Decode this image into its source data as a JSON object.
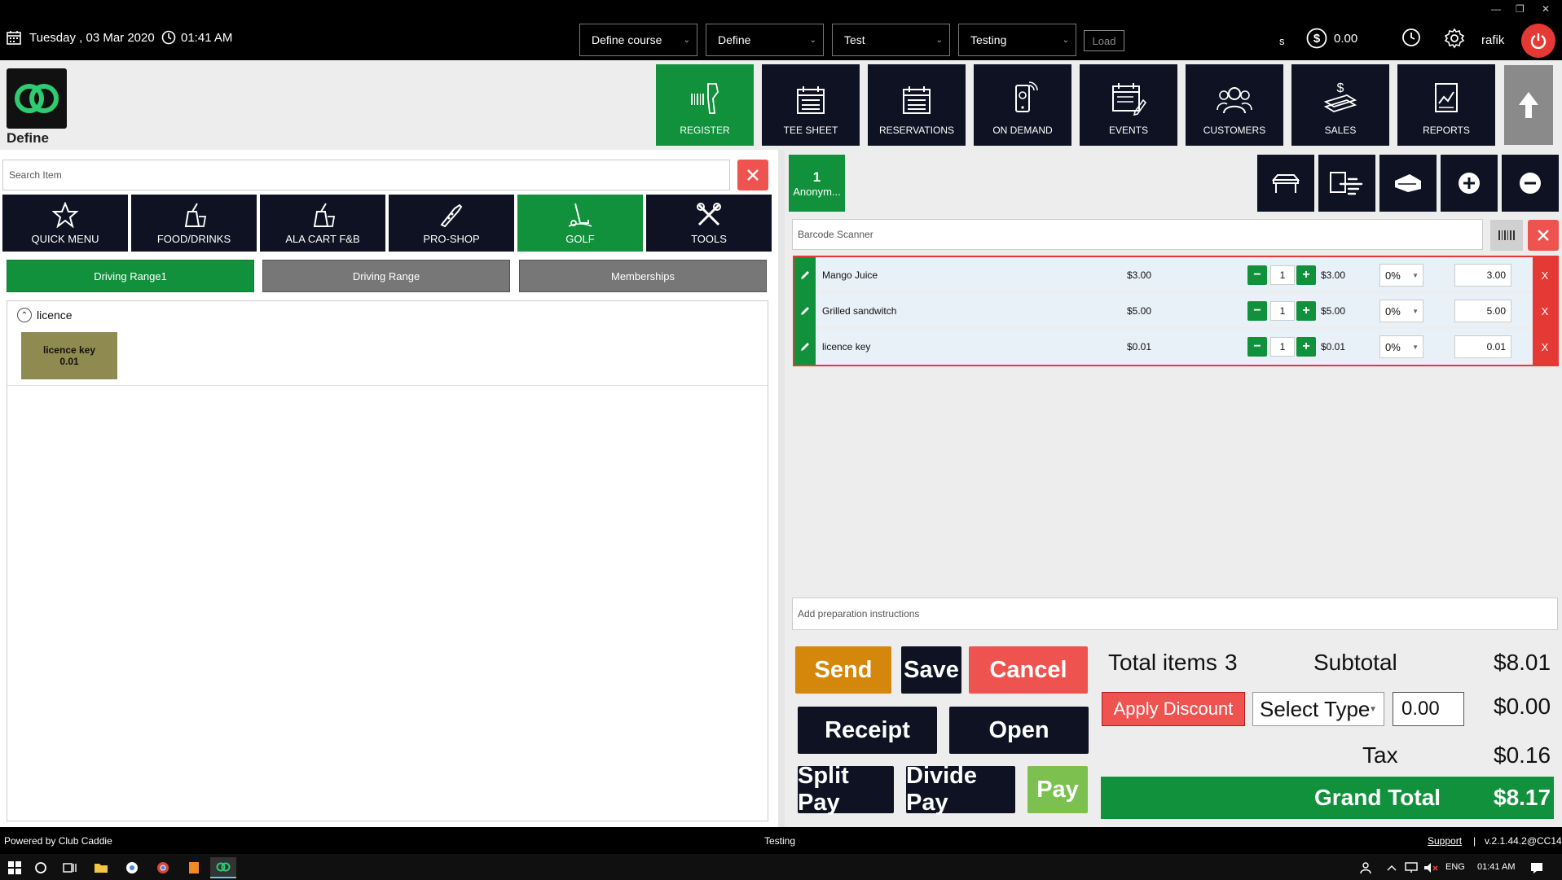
{
  "topbar": {
    "date": "Tuesday ,  03 Mar 2020",
    "time": "01:41 AM",
    "selects": [
      "Define course",
      "Define",
      "Test",
      "Testing"
    ],
    "load_label": "Load",
    "s_label": "s",
    "balance": "0.00",
    "user": "rafik"
  },
  "header": {
    "app_label": "Define",
    "nav": [
      {
        "label": "REGISTER",
        "icon": "barcode-scanner-icon",
        "active": true
      },
      {
        "label": "TEE SHEET",
        "icon": "calendar-icon"
      },
      {
        "label": "RESERVATIONS",
        "icon": "calendar-list-icon"
      },
      {
        "label": "ON DEMAND",
        "icon": "mobile-icon"
      },
      {
        "label": "EVENTS",
        "icon": "events-calendar-icon"
      },
      {
        "label": "CUSTOMERS",
        "icon": "customers-icon"
      },
      {
        "label": "SALES",
        "icon": "sales-icon"
      },
      {
        "label": "REPORTS",
        "icon": "reports-icon"
      }
    ]
  },
  "left": {
    "search_placeholder": "Search Item",
    "categories": [
      {
        "label": "QUICK MENU",
        "icon": "star-icon"
      },
      {
        "label": "FOOD/DRINKS",
        "icon": "food-drink-icon"
      },
      {
        "label": "ALA CART F&B",
        "icon": "ala-cart-icon"
      },
      {
        "label": "PRO-SHOP",
        "icon": "pro-shop-icon"
      },
      {
        "label": "GOLF",
        "icon": "golf-icon",
        "active": true
      },
      {
        "label": "TOOLS",
        "icon": "tools-icon"
      }
    ],
    "subtabs": [
      {
        "label": "Driving Range1",
        "active": true
      },
      {
        "label": "Driving Range"
      },
      {
        "label": "Memberships"
      }
    ],
    "group": {
      "title": "licence",
      "tile_name": "licence key",
      "tile_price": "0.01"
    }
  },
  "right": {
    "customer": {
      "count": "1",
      "name": "Anonym..."
    },
    "barcode_placeholder": "Barcode Scanner",
    "items": [
      {
        "name": "Mango Juice",
        "price": "$3.00",
        "qty": "1",
        "line_price": "$3.00",
        "discount": "0%",
        "total": "3.00"
      },
      {
        "name": "Grilled sandwitch",
        "price": "$5.00",
        "qty": "1",
        "line_price": "$5.00",
        "discount": "0%",
        "total": "5.00"
      },
      {
        "name": "licence key",
        "price": "$0.01",
        "qty": "1",
        "line_price": "$0.01",
        "discount": "0%",
        "total": "0.01"
      }
    ],
    "remove_label": "X",
    "prep_placeholder": "Add preparation instructions",
    "buttons": {
      "send": "Send",
      "save": "Save",
      "cancel": "Cancel",
      "receipt": "Receipt",
      "open": "Open",
      "split_pay": "Split Pay",
      "divide_pay": "Divide Pay",
      "pay": "Pay"
    },
    "summary": {
      "total_items_label": "Total items",
      "total_items": "3",
      "subtotal_label": "Subtotal",
      "subtotal": "$8.01",
      "apply_discount": "Apply Discount",
      "select_type": "Select Type",
      "discount_value": "0.00",
      "discount_amount": "$0.00",
      "tax_label": "Tax",
      "tax": "$0.16",
      "grand_total_label": "Grand Total",
      "grand_total": "$8.17"
    }
  },
  "footer": {
    "powered": "Powered by Club Caddie",
    "center": "Testing",
    "support": "Support",
    "separator": "|",
    "version": "v.2.1.44.2@CC14"
  },
  "taskbar": {
    "lang": "ENG",
    "time": "01:41 AM"
  },
  "colors": {
    "green": "#12913c",
    "navy": "#0f1222",
    "red": "#ef5350",
    "orange": "#d4870a",
    "light_green": "#7cc04f",
    "gold_tile": "#8f8a50"
  }
}
